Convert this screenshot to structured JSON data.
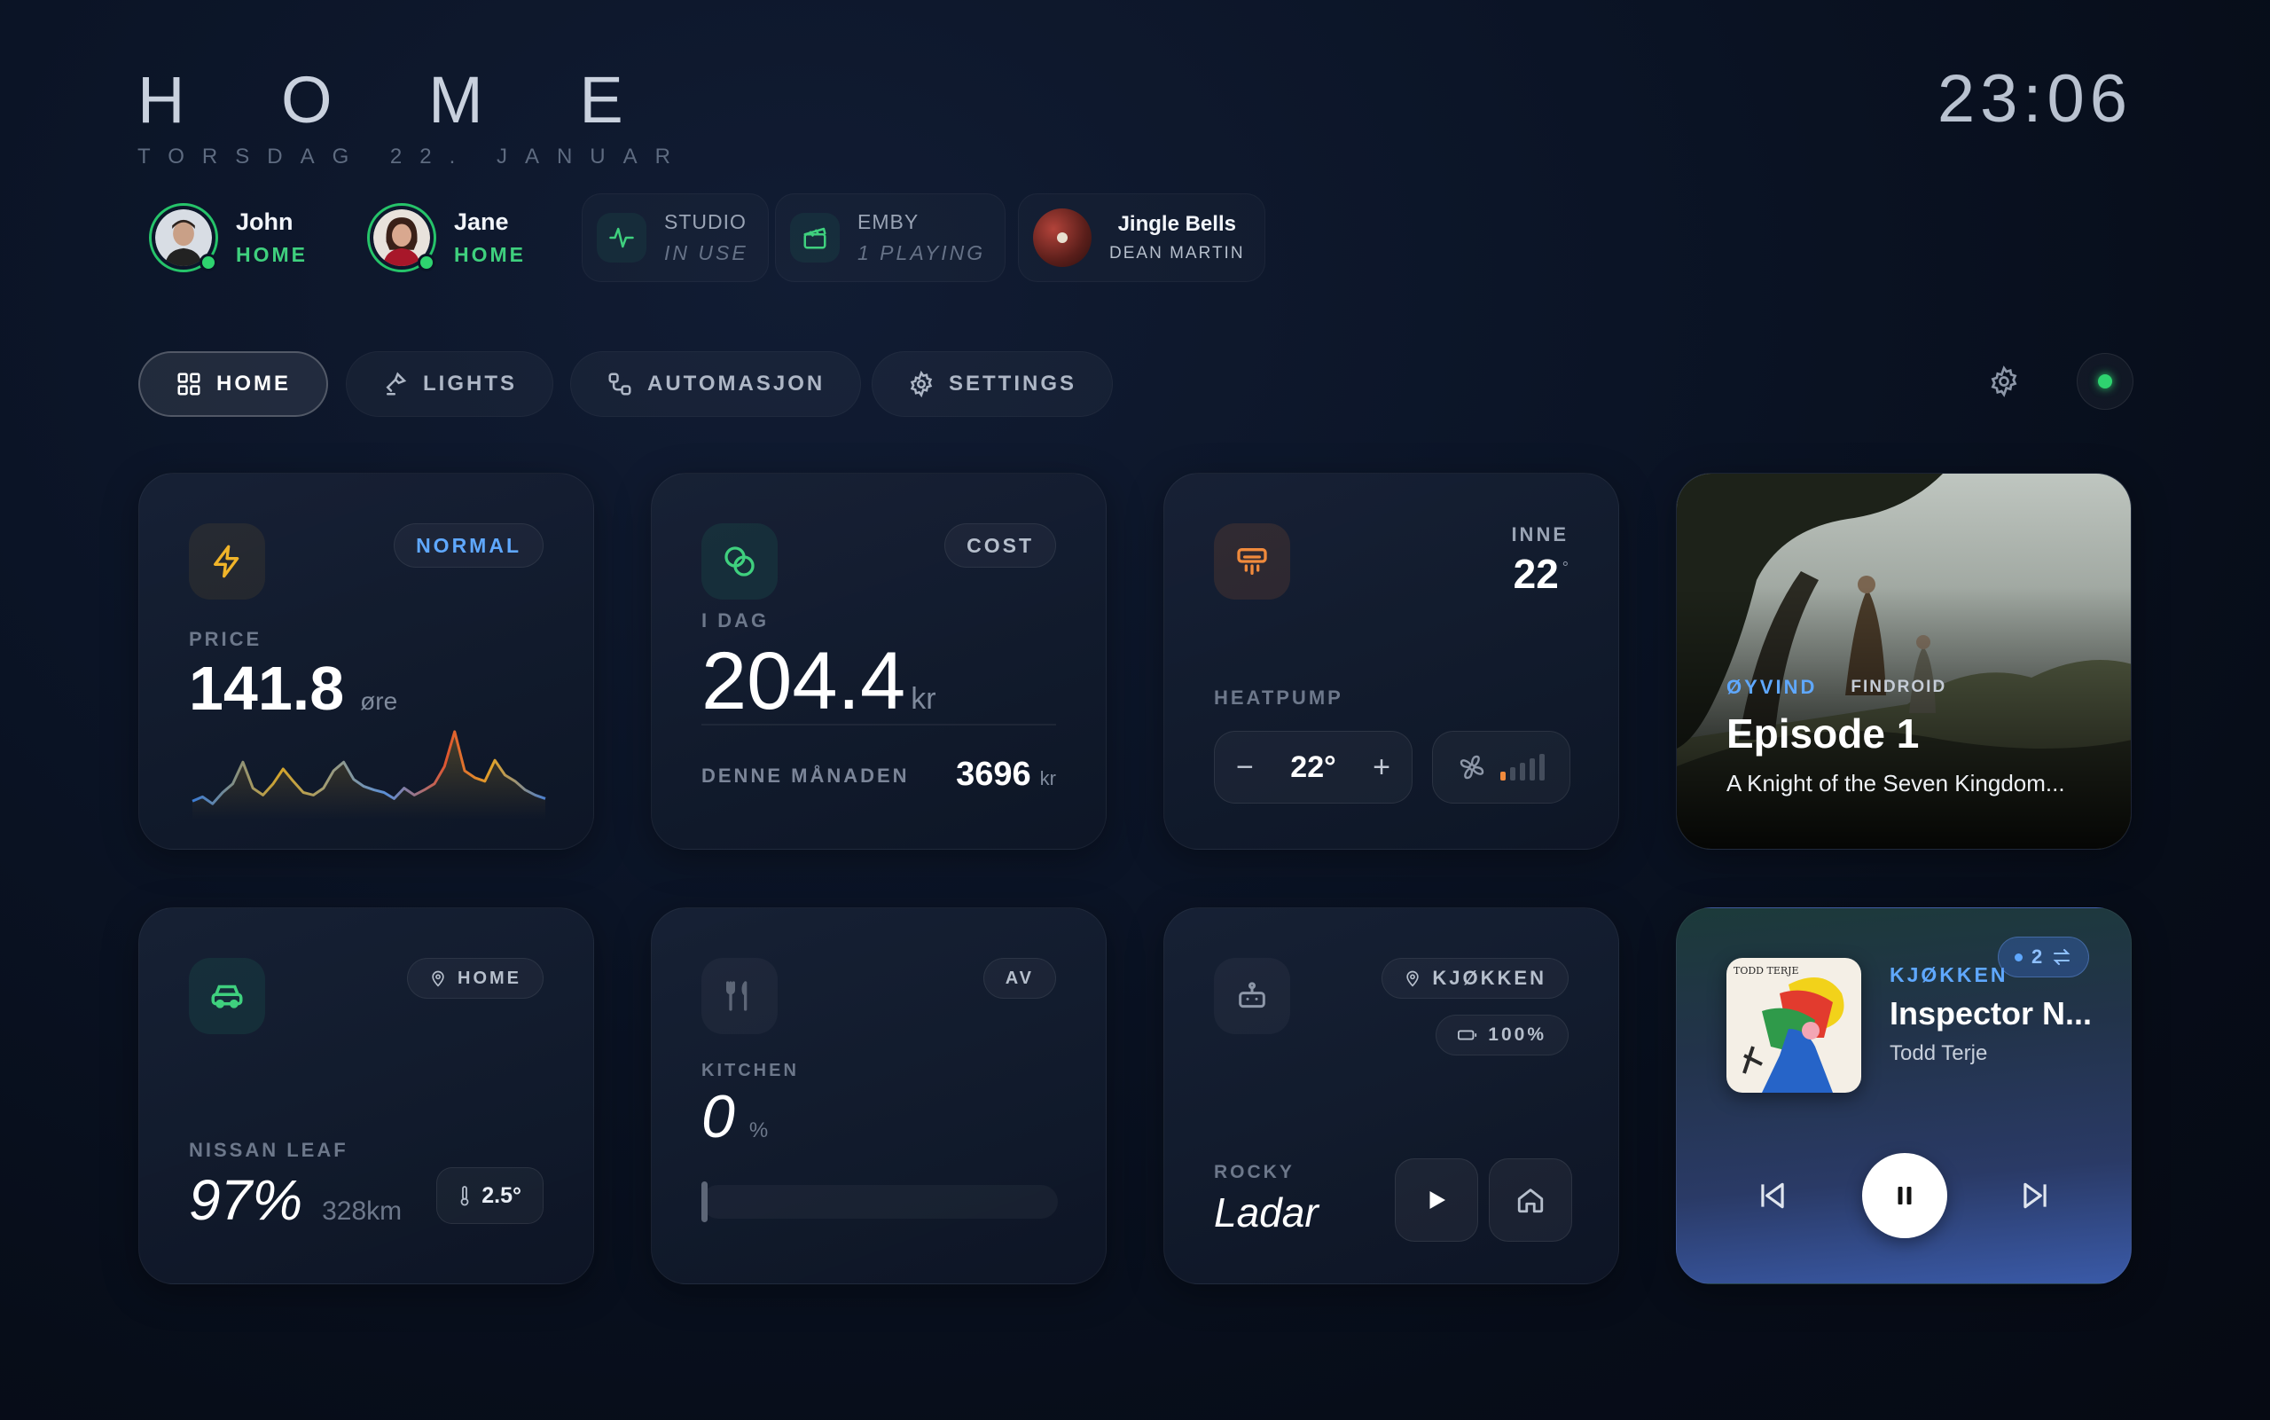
{
  "header": {
    "title": "H O M E",
    "date": "TORSDAG 22. JANUAR",
    "clock": "23:06"
  },
  "presence": [
    {
      "name": "John",
      "status": "HOME"
    },
    {
      "name": "Jane",
      "status": "HOME"
    }
  ],
  "devices": {
    "studio": {
      "label": "STUDIO",
      "status": "IN USE"
    },
    "emby": {
      "label": "EMBY",
      "status": "1 PLAYING"
    },
    "music": {
      "title": "Jingle Bells",
      "artist": "DEAN MARTIN"
    }
  },
  "nav": {
    "tabs": [
      {
        "label": "HOME",
        "icon": "grid-icon",
        "active": true
      },
      {
        "label": "LIGHTS",
        "icon": "lamp-icon",
        "active": false
      },
      {
        "label": "AUTOMASJON",
        "icon": "flow-icon",
        "active": false
      },
      {
        "label": "SETTINGS",
        "icon": "gear-icon",
        "active": false
      }
    ]
  },
  "price_card": {
    "badge": "NORMAL",
    "label": "PRICE",
    "value": "141.8",
    "unit": "øre",
    "sparkline": [
      0.15,
      0.2,
      0.12,
      0.25,
      0.35,
      0.6,
      0.3,
      0.22,
      0.35,
      0.52,
      0.38,
      0.25,
      0.22,
      0.3,
      0.5,
      0.6,
      0.4,
      0.32,
      0.28,
      0.25,
      0.18,
      0.3,
      0.22,
      0.28,
      0.35,
      0.55,
      0.95,
      0.5,
      0.42,
      0.38,
      0.62,
      0.45,
      0.38,
      0.28,
      0.22,
      0.18
    ],
    "accent": "#f0b429"
  },
  "cost_card": {
    "badge": "COST",
    "label": "I DAG",
    "value": "204.4",
    "unit": "kr",
    "month_label": "DENNE MÅNADEN",
    "month_value": "3696",
    "month_unit": "kr"
  },
  "heatpump_card": {
    "inside_label": "INNE",
    "inside_value": "22",
    "inside_unit": "°",
    "label": "HEATPUMP",
    "setpoint": "22°",
    "fan_level": 1
  },
  "episode_card": {
    "user": "ØYVIND",
    "client": "FINDROID",
    "title": "Episode 1",
    "subtitle": "A Knight of the Seven Kingdom..."
  },
  "car_card": {
    "location": "HOME",
    "label": "NISSAN LEAF",
    "battery": "97%",
    "range": "328km",
    "temperature": "2.5°"
  },
  "kitchen_card": {
    "state": "AV",
    "label": "KITCHEN",
    "value": "0",
    "unit": "%",
    "level": 0
  },
  "robot_card": {
    "room": "KJØKKEN",
    "battery": "100%",
    "name": "ROCKY",
    "status": "Ladar"
  },
  "music_card": {
    "room": "KJØKKEN",
    "group_count": "2",
    "title": "Inspector N...",
    "artist": "Todd Terje",
    "album_art_text": "TODD TERJE"
  }
}
